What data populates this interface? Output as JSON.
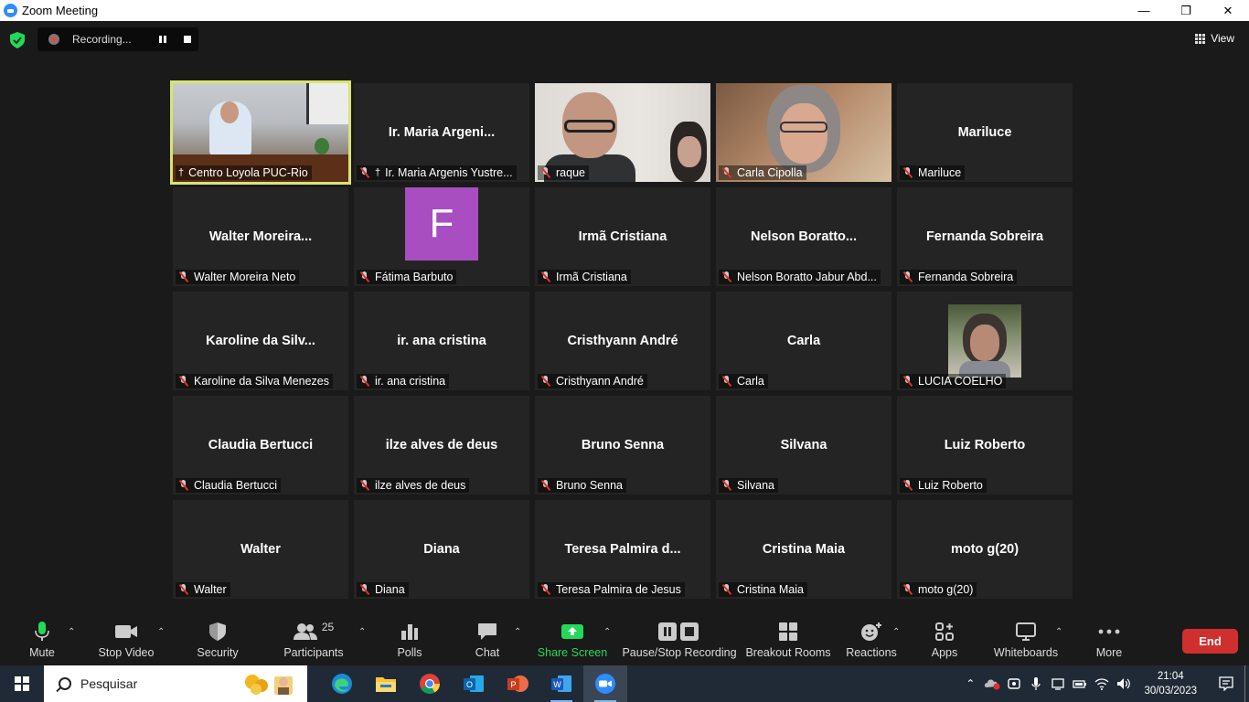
{
  "window": {
    "title": "Zoom Meeting",
    "controls": [
      "minimize",
      "maximize",
      "close"
    ]
  },
  "top": {
    "recording_label": "Recording...",
    "view_label": "View"
  },
  "tiles": [
    {
      "big": "",
      "label": "Centro Loyola PUC-Rio",
      "kind": "video-room",
      "pinned": true,
      "muted": false,
      "active": true
    },
    {
      "big": "Ir. Maria Argeni...",
      "label": "Ir. Maria Argenis Yustre...",
      "kind": "name",
      "pinned": true,
      "muted": true
    },
    {
      "big": "",
      "label": "raque",
      "kind": "video-raque",
      "muted": true
    },
    {
      "big": "",
      "label": "Carla Cipolla",
      "kind": "video-carla",
      "muted": true
    },
    {
      "big": "Mariluce",
      "label": "Mariluce",
      "kind": "name",
      "muted": true
    },
    {
      "big": "Walter  Moreira...",
      "label": "Walter Moreira Neto",
      "kind": "name",
      "muted": true
    },
    {
      "big": "F",
      "label": "Fátima Barbuto",
      "kind": "avatar",
      "muted": true
    },
    {
      "big": "Irmã Cristiana",
      "label": "Irmã Cristiana",
      "kind": "name",
      "muted": true
    },
    {
      "big": "Nelson  Boratto...",
      "label": "Nelson Boratto Jabur Abd...",
      "kind": "name",
      "muted": true
    },
    {
      "big": "Fernanda Sobreira",
      "label": "Fernanda Sobreira",
      "kind": "name",
      "muted": true
    },
    {
      "big": "Karoline  da  Silv...",
      "label": "Karoline da Silva Menezes",
      "kind": "name",
      "muted": true
    },
    {
      "big": "ir. ana cristina",
      "label": "ir. ana cristina",
      "kind": "name",
      "muted": true
    },
    {
      "big": "Cristhyann André",
      "label": "Cristhyann André",
      "kind": "name",
      "muted": true
    },
    {
      "big": "Carla",
      "label": "Carla",
      "kind": "name",
      "muted": true
    },
    {
      "big": "",
      "label": "LUCIA COELHO",
      "kind": "photo",
      "muted": true
    },
    {
      "big": "Claudia Bertucci",
      "label": "Claudia Bertucci",
      "kind": "name",
      "muted": true
    },
    {
      "big": "ilze alves de deus",
      "label": "ilze alves de deus",
      "kind": "name",
      "muted": true
    },
    {
      "big": "Bruno Senna",
      "label": "Bruno Senna",
      "kind": "name",
      "muted": true
    },
    {
      "big": "Silvana",
      "label": "Silvana",
      "kind": "name",
      "muted": true
    },
    {
      "big": "Luiz Roberto",
      "label": "Luiz Roberto",
      "kind": "name",
      "muted": true
    },
    {
      "big": "Walter",
      "label": "Walter",
      "kind": "name",
      "muted": true
    },
    {
      "big": "Diana",
      "label": "Diana",
      "kind": "name",
      "muted": true
    },
    {
      "big": "Teresa  Palmira  d...",
      "label": "Teresa Palmira de Jesus",
      "kind": "name",
      "muted": true
    },
    {
      "big": "Cristina Maia",
      "label": "Cristina Maia",
      "kind": "name",
      "muted": true
    },
    {
      "big": "moto g(20)",
      "label": "moto g(20)",
      "kind": "name",
      "muted": true
    }
  ],
  "toolbar": {
    "mute": "Mute",
    "stop_video": "Stop Video",
    "security": "Security",
    "participants": "Participants",
    "participants_count": "25",
    "polls": "Polls",
    "chat": "Chat",
    "share_screen": "Share Screen",
    "pause_stop_recording": "Pause/Stop Recording",
    "breakout_rooms": "Breakout Rooms",
    "reactions": "Reactions",
    "apps": "Apps",
    "whiteboards": "Whiteboards",
    "more": "More",
    "end": "End"
  },
  "colors": {
    "share_green": "#23d959",
    "end_red": "#d0302d",
    "active_speaker": "#d8e470",
    "avatar_purple": "#a94ec1"
  },
  "taskbar": {
    "search_placeholder": "Pesquisar",
    "apps": [
      "edge-icon",
      "file-explorer-icon",
      "chrome-icon",
      "outlook-icon",
      "powerpoint-icon",
      "word-icon",
      "zoom-icon"
    ],
    "time": "21:04",
    "date": "30/03/2023"
  }
}
